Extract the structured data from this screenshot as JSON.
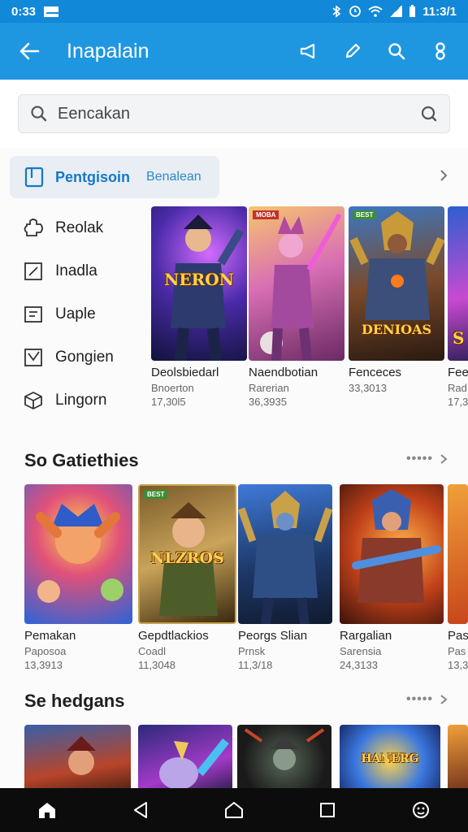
{
  "status_bar": {
    "time": "0:33",
    "time_right": "11:3/1"
  },
  "app_bar": {
    "title": "Inapalain"
  },
  "search": {
    "placeholder": "Eencakan"
  },
  "category": {
    "label": "Pentgisoin",
    "sublabel": "Benalean"
  },
  "sidebar": {
    "items": [
      {
        "label": "Reolak",
        "icon": "puzzle-icon"
      },
      {
        "label": "Inadla",
        "icon": "edit-square-icon"
      },
      {
        "label": "Uaple",
        "icon": "list-box-icon"
      },
      {
        "label": "Gongien",
        "icon": "check-square-icon"
      },
      {
        "label": "Lingorn",
        "icon": "cube-icon"
      }
    ]
  },
  "featured": {
    "cards": [
      {
        "name": "Deolsbiedarl",
        "dev": "Bnoerton",
        "count": "17,30l5",
        "art_text": "NERON",
        "badge": ""
      },
      {
        "name": "Naendbotian",
        "dev": "Rarerian",
        "count": "36,3935",
        "art_text": "",
        "badge": "MOBA"
      },
      {
        "name": "Fenceces",
        "dev": "33,3013",
        "count": "",
        "art_text": "DENIOAS",
        "badge": "BEST"
      },
      {
        "name": "Fee",
        "dev": "Rad",
        "count": "17,3",
        "art_text": "S",
        "badge": ""
      }
    ]
  },
  "section1": {
    "title": "So Gatiethies",
    "cards": [
      {
        "name": "Pemakan",
        "dev": "Paposoa",
        "count": "13,3913",
        "art_text": "",
        "badge": ""
      },
      {
        "name": "Gepdtlackios",
        "dev": "Coadl",
        "count": "11,3048",
        "art_text": "NLZROS",
        "badge": "BEST"
      },
      {
        "name": "Peorgs Slian",
        "dev": "Prnsk",
        "count": "11,3/18",
        "art_text": "",
        "badge": ""
      },
      {
        "name": "Rargalian",
        "dev": "Sarensia",
        "count": "24,3133",
        "art_text": "",
        "badge": ""
      },
      {
        "name": "Pas",
        "dev": "Pas",
        "count": "13,3",
        "art_text": "",
        "badge": ""
      }
    ]
  },
  "section2": {
    "title": "Se hedgans",
    "cards": [
      {
        "art_text": "",
        "badge": ""
      },
      {
        "art_text": "",
        "badge": ""
      },
      {
        "art_text": "",
        "badge": ""
      },
      {
        "art_text": "HANERG",
        "badge": ""
      },
      {
        "art_text": "",
        "badge": ""
      }
    ]
  },
  "colors": {
    "app_bar": "#1f97e0",
    "accent": "#1478c9",
    "nav_bar": "#0c0c0d"
  }
}
